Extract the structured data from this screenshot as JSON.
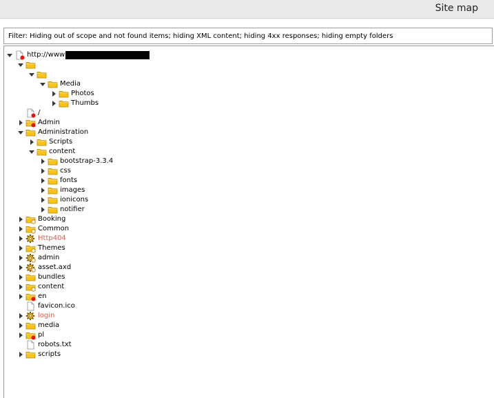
{
  "window": {
    "title": "Site map"
  },
  "filter": {
    "text": "Filter:  Hiding out of scope and not found items;  hiding XML content;  hiding 4xx responses;  hiding empty folders"
  },
  "tree": [
    {
      "depth": 0,
      "toggle": "expanded",
      "icon": "page",
      "badge": "red",
      "label": "http://www",
      "redacted": true,
      "style": "normal"
    },
    {
      "depth": 1,
      "toggle": "expanded",
      "icon": "folder",
      "badge": "none",
      "label": "",
      "style": "normal"
    },
    {
      "depth": 2,
      "toggle": "expanded",
      "icon": "folder",
      "badge": "none",
      "label": "",
      "style": "normal"
    },
    {
      "depth": 3,
      "toggle": "expanded",
      "icon": "folder",
      "badge": "none",
      "label": "Media",
      "style": "normal"
    },
    {
      "depth": 4,
      "toggle": "collapsed",
      "icon": "folder",
      "badge": "none",
      "label": "Photos",
      "style": "normal"
    },
    {
      "depth": 4,
      "toggle": "collapsed",
      "icon": "folder",
      "badge": "none",
      "label": "Thumbs",
      "style": "normal"
    },
    {
      "depth": 1,
      "toggle": "none",
      "icon": "page",
      "badge": "red",
      "label": "/",
      "style": "normal"
    },
    {
      "depth": 1,
      "toggle": "collapsed",
      "icon": "folder",
      "badge": "red",
      "label": "Admin",
      "style": "normal"
    },
    {
      "depth": 1,
      "toggle": "expanded",
      "icon": "folder",
      "badge": "none",
      "label": "Administration",
      "style": "normal"
    },
    {
      "depth": 2,
      "toggle": "collapsed",
      "icon": "folder",
      "badge": "none",
      "label": "Scripts",
      "style": "normal"
    },
    {
      "depth": 2,
      "toggle": "expanded",
      "icon": "folder",
      "badge": "none",
      "label": "content",
      "style": "normal"
    },
    {
      "depth": 3,
      "toggle": "collapsed",
      "icon": "folder",
      "badge": "none",
      "label": "bootstrap-3.3.4",
      "style": "normal"
    },
    {
      "depth": 3,
      "toggle": "collapsed",
      "icon": "folder",
      "badge": "none",
      "label": "css",
      "style": "normal"
    },
    {
      "depth": 3,
      "toggle": "collapsed",
      "icon": "folder",
      "badge": "none",
      "label": "fonts",
      "style": "normal"
    },
    {
      "depth": 3,
      "toggle": "collapsed",
      "icon": "folder",
      "badge": "none",
      "label": "images",
      "style": "normal"
    },
    {
      "depth": 3,
      "toggle": "collapsed",
      "icon": "folder",
      "badge": "none",
      "label": "ionicons",
      "style": "normal"
    },
    {
      "depth": 3,
      "toggle": "collapsed",
      "icon": "folder",
      "badge": "none",
      "label": "notifier",
      "style": "normal"
    },
    {
      "depth": 1,
      "toggle": "collapsed",
      "icon": "folder",
      "badge": "hollow",
      "label": "Booking",
      "style": "normal"
    },
    {
      "depth": 1,
      "toggle": "collapsed",
      "icon": "folder",
      "badge": "hollow",
      "label": "Common",
      "style": "normal"
    },
    {
      "depth": 1,
      "toggle": "collapsed",
      "icon": "gear",
      "badge": "none",
      "label": "Http404",
      "style": "red"
    },
    {
      "depth": 1,
      "toggle": "collapsed",
      "icon": "folder",
      "badge": "hollow",
      "label": "Themes",
      "style": "normal"
    },
    {
      "depth": 1,
      "toggle": "collapsed",
      "icon": "gear",
      "badge": "hollow",
      "label": "admin",
      "style": "normal"
    },
    {
      "depth": 1,
      "toggle": "collapsed",
      "icon": "gear",
      "badge": "hollow",
      "label": "asset.axd",
      "style": "normal"
    },
    {
      "depth": 1,
      "toggle": "collapsed",
      "icon": "folder",
      "badge": "none",
      "label": "bundles",
      "style": "normal"
    },
    {
      "depth": 1,
      "toggle": "collapsed",
      "icon": "folder",
      "badge": "hollow",
      "label": "content",
      "style": "normal"
    },
    {
      "depth": 1,
      "toggle": "collapsed",
      "icon": "folder",
      "badge": "red",
      "label": "en",
      "style": "normal"
    },
    {
      "depth": 1,
      "toggle": "none",
      "icon": "page",
      "badge": "none",
      "label": "favicon.ico",
      "style": "normal"
    },
    {
      "depth": 1,
      "toggle": "collapsed",
      "icon": "gear",
      "badge": "none",
      "label": "login",
      "style": "red"
    },
    {
      "depth": 1,
      "toggle": "collapsed",
      "icon": "folder",
      "badge": "none",
      "label": "media",
      "style": "normal"
    },
    {
      "depth": 1,
      "toggle": "collapsed",
      "icon": "folder",
      "badge": "red",
      "label": "pl",
      "style": "normal"
    },
    {
      "depth": 1,
      "toggle": "none",
      "icon": "page",
      "badge": "none",
      "label": "robots.txt",
      "style": "normal"
    },
    {
      "depth": 1,
      "toggle": "collapsed",
      "icon": "folder",
      "badge": "none",
      "label": "scripts",
      "style": "normal"
    }
  ],
  "colors": {
    "folder_fill": "#f6c21b",
    "folder_stroke": "#b8880a",
    "red_badge": "#e8130f",
    "red_label": "#e0584e",
    "title_bar": "#e9e9e9"
  }
}
